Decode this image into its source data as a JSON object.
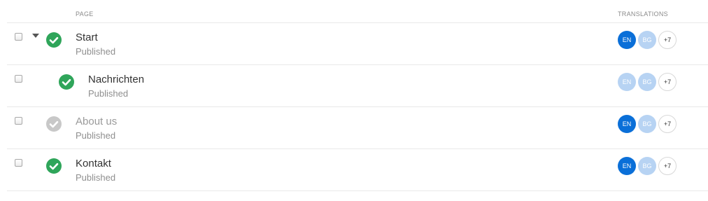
{
  "columns": {
    "page": "PAGE",
    "translations": "TRANSLATIONS"
  },
  "colors": {
    "published": "#2fa55a",
    "unpublished": "#c8c8c8",
    "lang_active": "#0a6fd8",
    "lang_inactive": "#b7d3f3"
  },
  "rows": [
    {
      "title": "Start",
      "subtitle": "Published",
      "expanded": true,
      "indent_level": 0,
      "status_icon": "check-icon",
      "published": true,
      "langs": [
        {
          "label": "EN",
          "active": true
        },
        {
          "label": "BG",
          "active": false
        }
      ],
      "more": "+7"
    },
    {
      "title": "Nachrichten",
      "subtitle": "Published",
      "expanded": false,
      "indent_level": 1,
      "status_icon": "check-icon",
      "published": true,
      "langs": [
        {
          "label": "EN",
          "active": false
        },
        {
          "label": "BG",
          "active": false
        }
      ],
      "more": "+7"
    },
    {
      "title": "About us",
      "subtitle": "Published",
      "expanded": false,
      "indent_level": 0,
      "status_icon": "check-icon",
      "published": false,
      "langs": [
        {
          "label": "EN",
          "active": true
        },
        {
          "label": "BG",
          "active": false
        }
      ],
      "more": "+7"
    },
    {
      "title": "Kontakt",
      "subtitle": "Published",
      "expanded": false,
      "indent_level": 0,
      "status_icon": "check-icon",
      "published": true,
      "langs": [
        {
          "label": "EN",
          "active": true
        },
        {
          "label": "BG",
          "active": false
        }
      ],
      "more": "+7"
    }
  ]
}
